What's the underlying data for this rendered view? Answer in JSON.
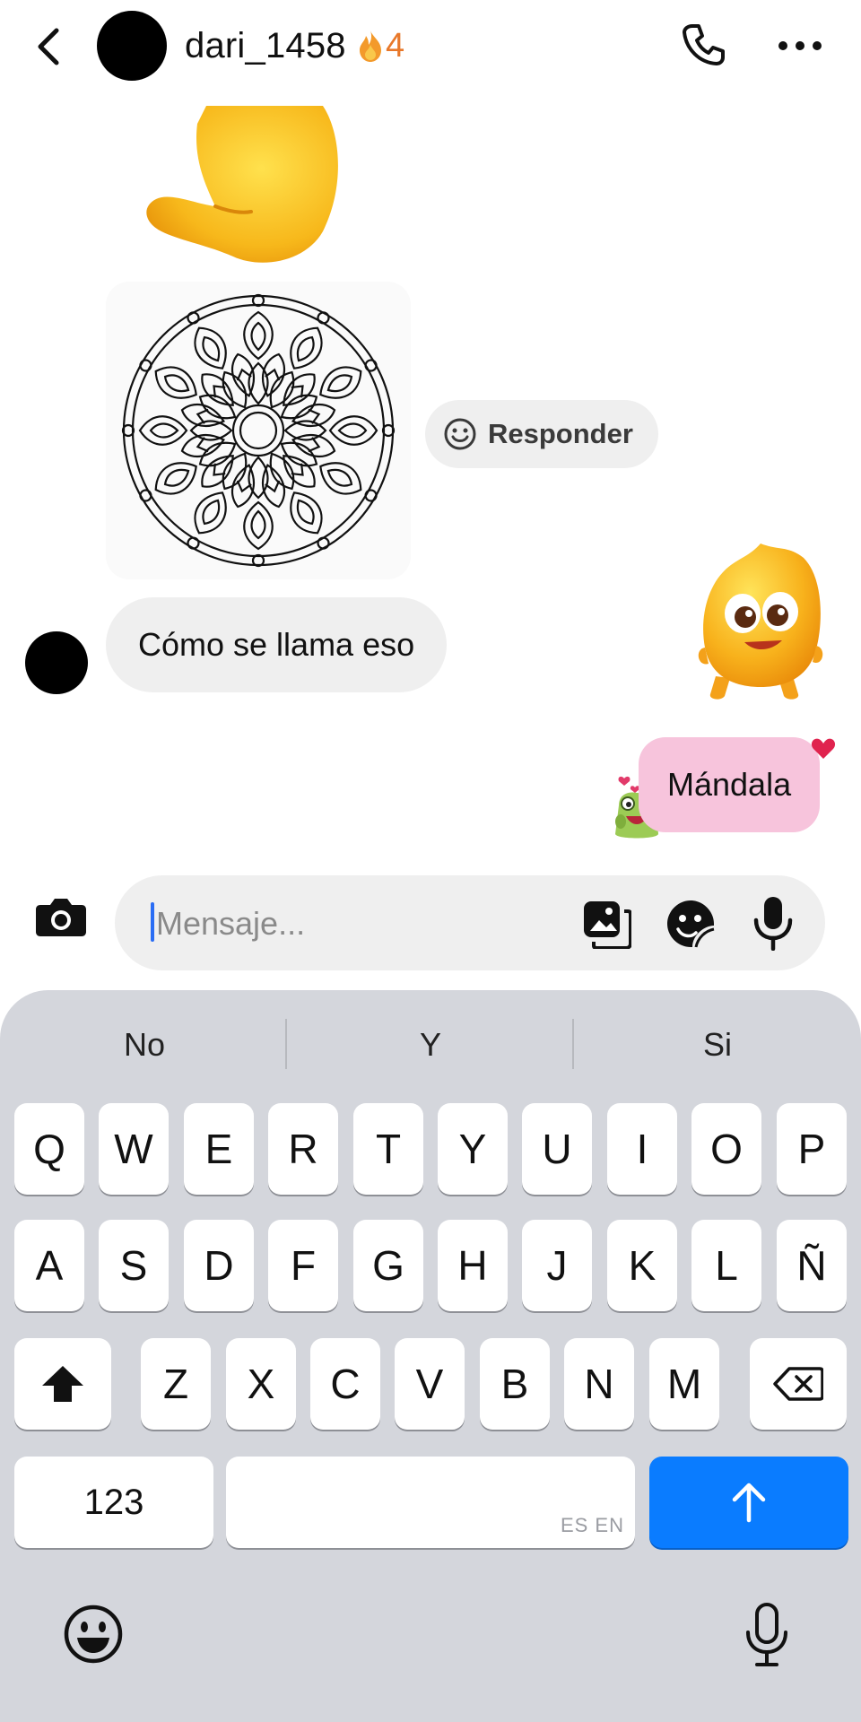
{
  "header": {
    "username": "dari_1458",
    "streak_count": "4",
    "back_icon": "chevron-left-icon",
    "call_icon": "phone-icon",
    "more_icon": "ellipsis-icon"
  },
  "conversation": {
    "reply_label": "Responder",
    "incoming_message": "Cómo se llama eso",
    "outgoing_message": "Mándala"
  },
  "composer": {
    "placeholder": "Mensaje..."
  },
  "keyboard": {
    "suggestions": [
      "No",
      "Y",
      "Si"
    ],
    "row1": [
      "Q",
      "W",
      "E",
      "R",
      "T",
      "Y",
      "U",
      "I",
      "O",
      "P"
    ],
    "row2": [
      "A",
      "S",
      "D",
      "F",
      "G",
      "H",
      "J",
      "K",
      "L",
      "Ñ"
    ],
    "row3": [
      "Z",
      "X",
      "C",
      "V",
      "B",
      "N",
      "M"
    ],
    "numbers_label": "123",
    "space_languages": "ES EN"
  },
  "colors": {
    "accent_blue": "#0a7cff",
    "outgoing_bubble": "#f7c4dc",
    "incoming_bubble": "#efefef",
    "streak": "#e8782a",
    "keyboard_bg": "#d4d6dc"
  }
}
